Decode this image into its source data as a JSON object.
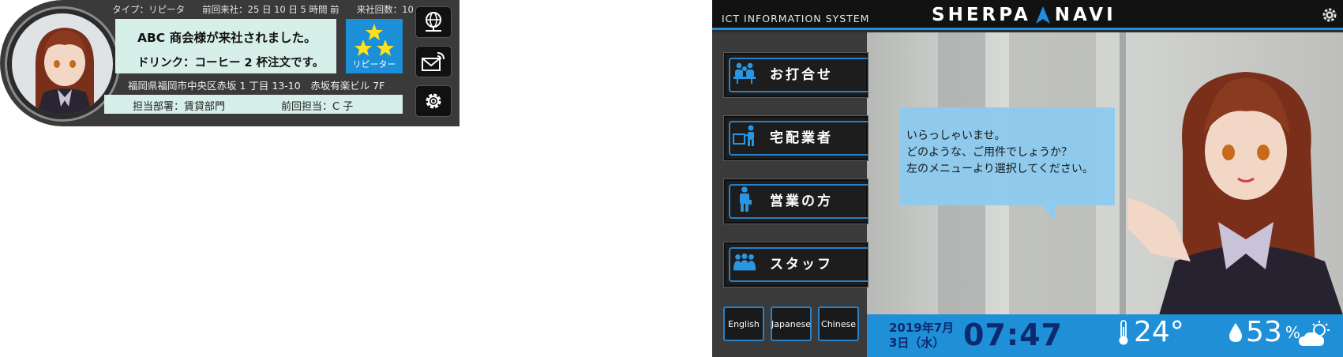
{
  "card": {
    "type_info": "タイプ：リピータ",
    "last_visit": "前回来社：25 日 10 日 5 時間 前",
    "visit_count": "来社回数：10",
    "message_1": "ABC 商会様が来社されました。",
    "message_2": "ドリンク：コーヒー 2 杯注文です。",
    "badge_label": "リピーター",
    "badge_stars": 3,
    "address": "福岡県福岡市中央区赤坂 1 丁目 13-10　赤坂有楽ビル 7F",
    "department": "担当部署：賃貸部門",
    "previous_person": "前回担当：C 子",
    "icons": [
      "globe-network-icon",
      "mail-wireless-icon",
      "gear-icon"
    ]
  },
  "kiosk": {
    "system_title": "ICT INFORMATION SYSTEM",
    "logo_left": "SHERPA",
    "logo_right": "NAVI",
    "menu": [
      {
        "label": "お打合せ",
        "icon": "meeting-icon"
      },
      {
        "label": "宅配業者",
        "icon": "delivery-icon"
      },
      {
        "label": "営業の方",
        "icon": "salesperson-icon"
      },
      {
        "label": "スタッフ",
        "icon": "staff-icon"
      }
    ],
    "languages": [
      "English",
      "Japanese",
      "Chinese"
    ],
    "bubble": {
      "line1": "いらっしゃいませ。",
      "line2": "どのような、ご用件でしょうか？",
      "line3": "左のメニューより選択してください。"
    },
    "date_line1": "2019年7月",
    "date_line2": "3日（水）",
    "time": "07:47",
    "temperature": "24°",
    "humidity": "53",
    "humidity_unit": "%",
    "colors": {
      "accent": "#1f8fd8",
      "header": "#121212",
      "panel": "#3a3a3a"
    }
  }
}
